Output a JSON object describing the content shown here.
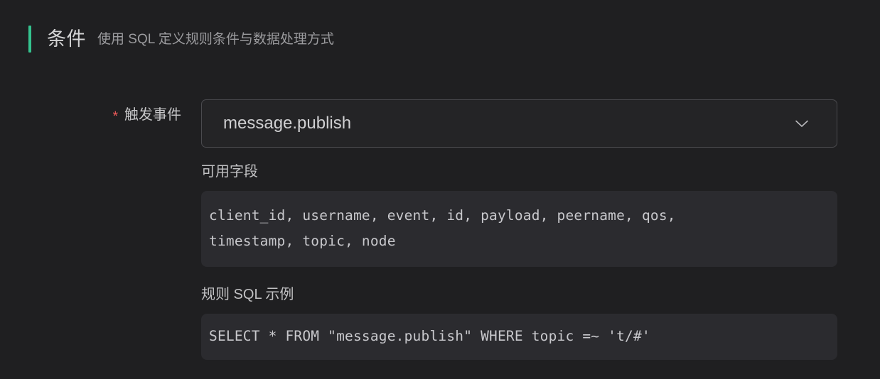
{
  "section": {
    "title": "条件",
    "subtitle": "使用 SQL 定义规则条件与数据处理方式",
    "accent_color": "#34c38f"
  },
  "form": {
    "trigger_event": {
      "required_marker": "*",
      "label": "触发事件",
      "selected_value": "message.publish",
      "dropdown_icon": "chevron-down-icon"
    }
  },
  "available_fields": {
    "label": "可用字段",
    "lines": [
      "client_id, username, event, id, payload, peername, qos,",
      "timestamp, topic, node"
    ]
  },
  "sql_example": {
    "label": "规则 SQL 示例",
    "code": "SELECT * FROM \"message.publish\" WHERE topic =~ 't/#'"
  },
  "colors": {
    "page_background": "#1f1f21",
    "code_background": "#2b2b2f",
    "select_background": "#242426",
    "select_border": "#4a4a4e",
    "required_red": "#f35b5b",
    "text_primary": "#d3d3d4",
    "text_secondary": "#9b9b9e",
    "code_text": "#c8c8cc"
  }
}
